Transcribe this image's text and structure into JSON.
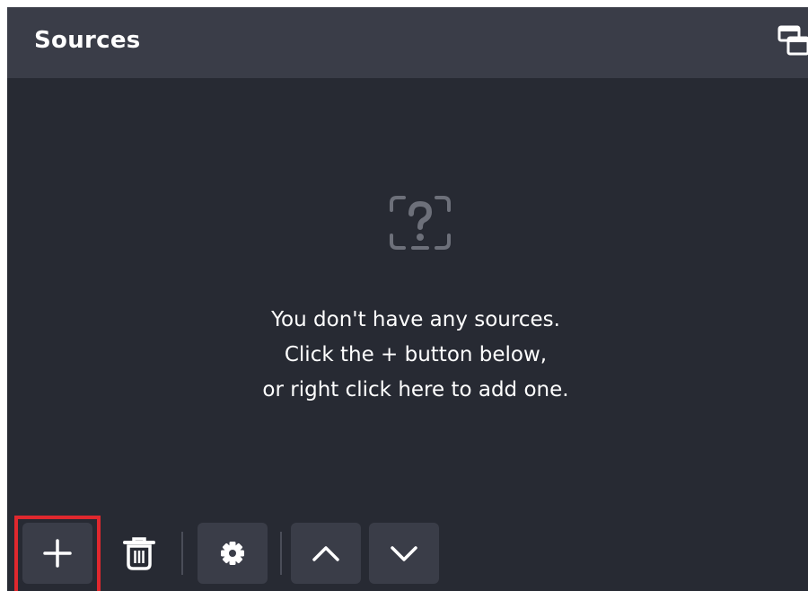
{
  "dock": {
    "title": "Sources"
  },
  "empty_state": {
    "icon": "question-box-icon",
    "line1": "You don't have any sources.",
    "line2": "Click the + button below,",
    "line3": "or right click here to add one."
  },
  "toolbar": {
    "buttons": [
      {
        "name": "add-source-button",
        "icon": "plus-icon",
        "highlighted": true
      },
      {
        "name": "remove-source-button",
        "icon": "trash-icon"
      },
      {
        "name": "source-properties-button",
        "icon": "gear-icon"
      },
      {
        "name": "move-source-up-button",
        "icon": "chevron-up-icon"
      },
      {
        "name": "move-source-down-button",
        "icon": "chevron-down-icon"
      }
    ]
  },
  "colors": {
    "panel_bg": "#272a33",
    "header_bg": "#3a3d48",
    "button_bg": "#3a3d48",
    "text": "#ffffff",
    "highlight": "#e0282e"
  }
}
